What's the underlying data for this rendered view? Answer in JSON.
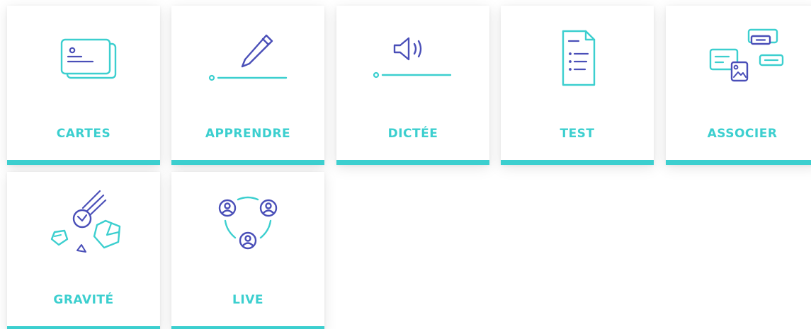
{
  "modes": [
    {
      "label": "CARTES",
      "icon": "flashcards-icon"
    },
    {
      "label": "APPRENDRE",
      "icon": "pencil-icon"
    },
    {
      "label": "DICTÉE",
      "icon": "speaker-icon"
    },
    {
      "label": "TEST",
      "icon": "test-document-icon"
    },
    {
      "label": "ASSOCIER",
      "icon": "match-icon"
    },
    {
      "label": "GRAVITÉ",
      "icon": "asteroid-icon"
    },
    {
      "label": "LIVE",
      "icon": "live-group-icon"
    }
  ],
  "colors": {
    "accent": "#3ccfcf",
    "icon_dark": "#4a4fb8"
  }
}
